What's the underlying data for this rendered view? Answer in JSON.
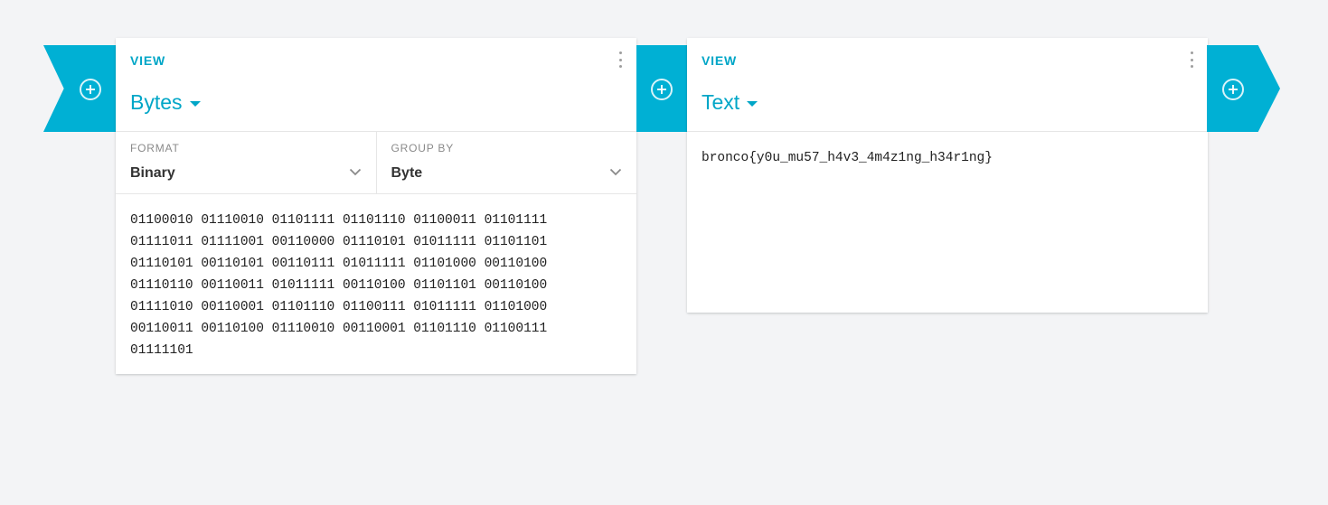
{
  "connectors": {
    "add_icon": "plus-circle-icon",
    "color": "#00b0d4"
  },
  "bytes_card": {
    "view_label": "VIEW",
    "title": "Bytes",
    "format": {
      "label": "FORMAT",
      "value": "Binary"
    },
    "group_by": {
      "label": "GROUP BY",
      "value": "Byte"
    },
    "content": "01100010 01110010 01101111 01101110 01100011 01101111\n01111011 01111001 00110000 01110101 01011111 01101101\n01110101 00110101 00110111 01011111 01101000 00110100\n01110110 00110011 01011111 00110100 01101101 00110100\n01111010 00110001 01101110 01100111 01011111 01101000\n00110011 00110100 01110010 00110001 01101110 01100111\n01111101"
  },
  "text_card": {
    "view_label": "VIEW",
    "title": "Text",
    "content": "bronco{y0u_mu57_h4v3_4m4z1ng_h34r1ng}"
  },
  "accent_color": "#00a6c7"
}
